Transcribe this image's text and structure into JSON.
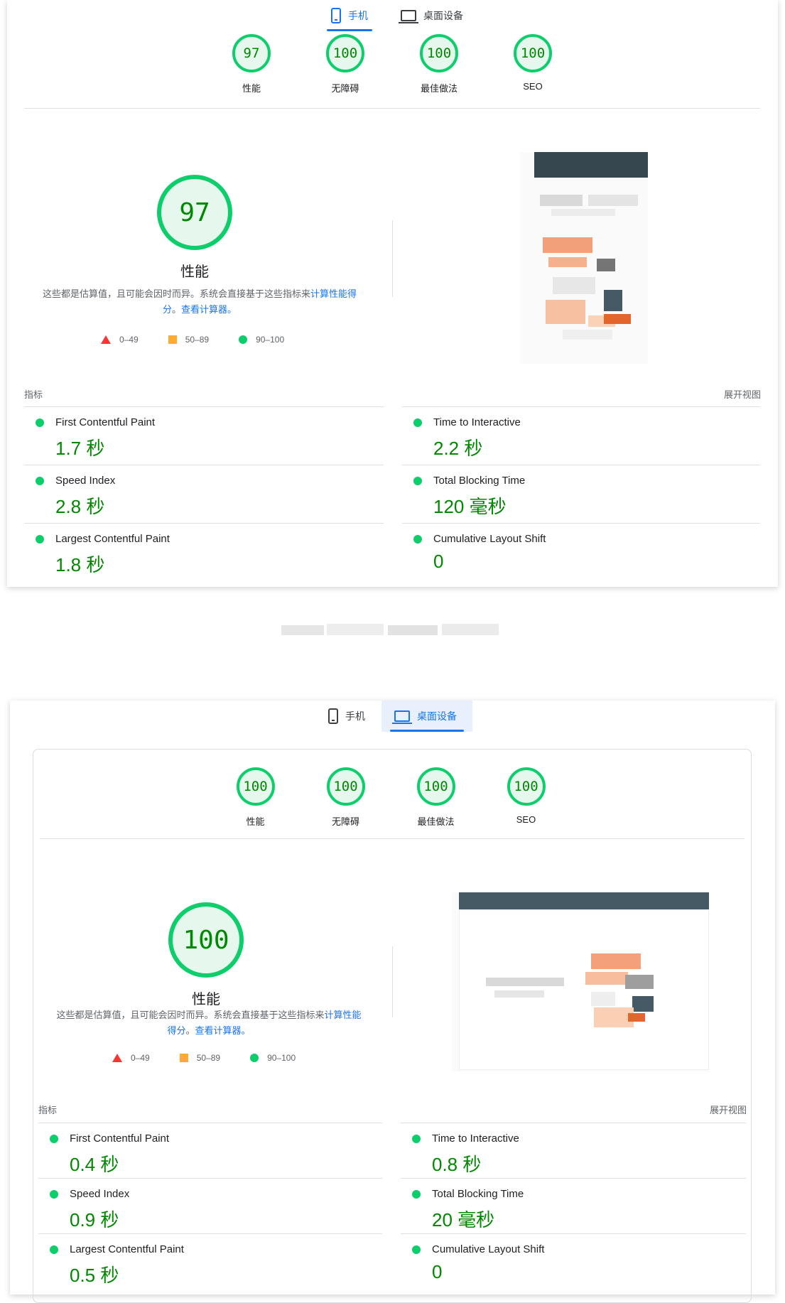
{
  "tabs": {
    "mobile": "手机",
    "desktop": "桌面设备"
  },
  "colors": {
    "pass": "#0cce6b",
    "pass_text": "#008800",
    "average": "#ffaa33",
    "fail": "#ff3333",
    "accent": "#1a73e8"
  },
  "icons": {
    "mobile": "phone-icon",
    "desktop": "laptop-icon",
    "fail": "triangle-icon",
    "average": "square-icon",
    "pass": "circle-icon"
  },
  "legend": {
    "fail": "0–49",
    "average": "50–89",
    "pass": "90–100"
  },
  "description": {
    "text": "这些都是估算值，且可能会因时而异。系统会直接基于这些指标来",
    "link1": "计算性能得分",
    "sep": "。",
    "link2": "查看计算器。"
  },
  "metrics_heading": "指标",
  "expand_view": "展开视图",
  "mobile": {
    "categories": [
      {
        "score": "97",
        "label": "性能"
      },
      {
        "score": "100",
        "label": "无障碍"
      },
      {
        "score": "100",
        "label": "最佳做法"
      },
      {
        "score": "100",
        "label": "SEO"
      }
    ],
    "performance": {
      "score": "97",
      "label": "性能"
    },
    "metrics": [
      {
        "name": "First Contentful Paint",
        "value": "1.7 秒"
      },
      {
        "name": "Time to Interactive",
        "value": "2.2 秒"
      },
      {
        "name": "Speed Index",
        "value": "2.8 秒"
      },
      {
        "name": "Total Blocking Time",
        "value": "120 毫秒"
      },
      {
        "name": "Largest Contentful Paint",
        "value": "1.8 秒"
      },
      {
        "name": "Cumulative Layout Shift",
        "value": "0"
      }
    ]
  },
  "desktop": {
    "categories": [
      {
        "score": "100",
        "label": "性能"
      },
      {
        "score": "100",
        "label": "无障碍"
      },
      {
        "score": "100",
        "label": "最佳做法"
      },
      {
        "score": "100",
        "label": "SEO"
      }
    ],
    "performance": {
      "score": "100",
      "label": "性能"
    },
    "metrics": [
      {
        "name": "First Contentful Paint",
        "value": "0.4 秒"
      },
      {
        "name": "Time to Interactive",
        "value": "0.8 秒"
      },
      {
        "name": "Speed Index",
        "value": "0.9 秒"
      },
      {
        "name": "Total Blocking Time",
        "value": "20 毫秒"
      },
      {
        "name": "Largest Contentful Paint",
        "value": "0.5 秒"
      },
      {
        "name": "Cumulative Layout Shift",
        "value": "0"
      }
    ]
  }
}
